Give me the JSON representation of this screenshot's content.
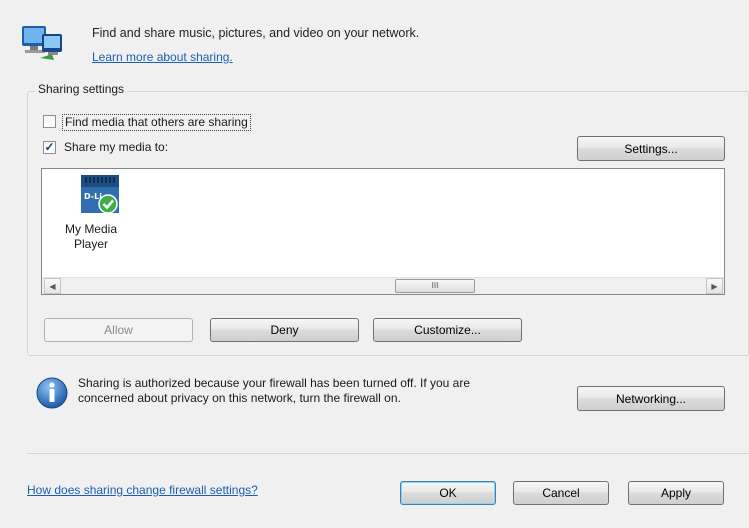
{
  "header": {
    "description": "Find and share music, pictures, and video on your network.",
    "learn_more_link": "Learn more about sharing."
  },
  "sharing_settings": {
    "legend": "Sharing settings",
    "find_media": {
      "label": "Find media that others are sharing",
      "checked": false
    },
    "share_media": {
      "label": "Share my media to:",
      "checked": true
    },
    "settings_button": "Settings...",
    "devices": [
      {
        "name": "My Media Player",
        "line1": "My Media",
        "line2": "Player",
        "icon": "d-link-media-device-icon",
        "allowed": true
      }
    ],
    "scroll_thumb_glyph": "III",
    "buttons": {
      "allow": "Allow",
      "deny": "Deny",
      "customize": "Customize..."
    }
  },
  "info": {
    "icon": "information-icon",
    "line1": "Sharing is authorized because your firewall has been turned off. If you are",
    "line2": "concerned about privacy on this network, turn the firewall on.",
    "networking_button": "Networking..."
  },
  "footer": {
    "firewall_link": "How does sharing change firewall settings?",
    "ok": "OK",
    "cancel": "Cancel",
    "apply": "Apply"
  },
  "colors": {
    "link": "#1a5fb4",
    "window_bg": "#f0f0f0",
    "default_button_border": "#3c7fb1"
  }
}
